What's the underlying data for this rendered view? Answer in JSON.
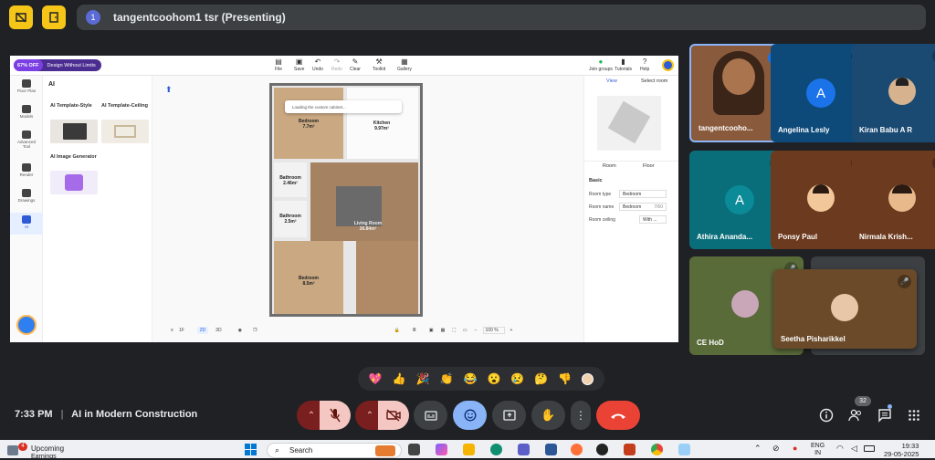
{
  "meeting": {
    "presenter_number": "1",
    "title": "tangentcoohom1 tsr (Presenting)",
    "time": "7:33 PM",
    "separator": "|",
    "name": "AI in Modern Construction",
    "people_count": "32"
  },
  "shared_app": {
    "promo_off": "67% OFF",
    "promo_text": "Design Without Limits",
    "toolbar": [
      {
        "label": "File"
      },
      {
        "label": "Save"
      },
      {
        "label": "Undo"
      },
      {
        "label": "Redo"
      },
      {
        "label": "Clear"
      },
      {
        "label": "Toolkit"
      },
      {
        "label": "Gallery"
      }
    ],
    "top_right": [
      {
        "label": "Join groups"
      },
      {
        "label": "Tutorials"
      },
      {
        "label": "Help"
      }
    ],
    "left_nav": [
      {
        "label": "Floor Plan"
      },
      {
        "label": "Models"
      },
      {
        "label": "Advanced Tool"
      },
      {
        "label": "Render"
      },
      {
        "label": "Drawings"
      },
      {
        "label": "AI"
      }
    ],
    "panel_title": "AI",
    "cards": [
      {
        "label": "AI Template-Style"
      },
      {
        "label": "AI Template-Ceiling"
      },
      {
        "label": "AI Image Generator"
      }
    ],
    "toast": "Loading the custom cabinet...",
    "rooms": [
      {
        "name": "Bedroom",
        "area": "7.7m²"
      },
      {
        "name": "Kitchen",
        "area": "9.97m²"
      },
      {
        "name": "Bathroom",
        "area": "2.46m²"
      },
      {
        "name": "Bathroom",
        "area": "2.5m²"
      },
      {
        "name": "Living Room",
        "area": "26.84m²"
      },
      {
        "name": "Bedroom",
        "area": "8.5m²"
      }
    ],
    "view_tabs": [
      {
        "label": "View"
      },
      {
        "label": "Select room"
      }
    ],
    "prop_tabs": [
      {
        "label": "Room"
      },
      {
        "label": "Floor"
      }
    ],
    "basic": "Basic",
    "props": {
      "room_type_label": "Room type",
      "room_type_value": "Bedroom",
      "room_name_label": "Room name",
      "room_name_value": "Bedroom",
      "room_name_count": "7/60",
      "room_ceiling_label": "Room ceiling",
      "room_ceiling_value": "With ..."
    },
    "bottom": {
      "floor": "1F",
      "mode2d": "2D",
      "mode3d": "3D",
      "zoom": "100",
      "zoom_unit": "%"
    }
  },
  "participants": [
    {
      "name": "tangentcooho...",
      "type": "video",
      "bg": "#8a5a3c"
    },
    {
      "name": "Angelina Lesly",
      "type": "letter",
      "letter": "A",
      "bg": "#0d4a7a",
      "circle": "#1a73e8"
    },
    {
      "name": "Kiran Babu A R",
      "type": "photo",
      "bg": "#1a4a72"
    },
    {
      "name": "Athira Ananda...",
      "type": "letter",
      "letter": "A",
      "bg": "#0a6e7a",
      "circle": "#0b8a97"
    },
    {
      "name": "Ponsy Paul",
      "type": "photo",
      "bg": "#6b3a1f"
    },
    {
      "name": "Nirmala Krish...",
      "type": "photo",
      "bg": "#6b3a1f"
    },
    {
      "name": "CE HoD",
      "type": "photo",
      "bg": "#5a6b3a"
    },
    {
      "name": "Seetha Pisharikkel",
      "type": "photo",
      "bg": "#6b4a2a"
    }
  ],
  "reactions": [
    "💖",
    "👍",
    "🎉",
    "👏",
    "😂",
    "😮",
    "😢",
    "🤔",
    "👎"
  ],
  "taskbar": {
    "weather_badge": "4",
    "weather_title": "Upcoming",
    "weather_sub": "Earnings",
    "search": "Search",
    "lang": "ENG",
    "lang2": "IN",
    "clock": "19:33",
    "date": "29-05-2025"
  },
  "colors": {
    "end_call": "#ea4335",
    "accent": "#8ab4f8",
    "mic_off": "#f4c7c3"
  }
}
